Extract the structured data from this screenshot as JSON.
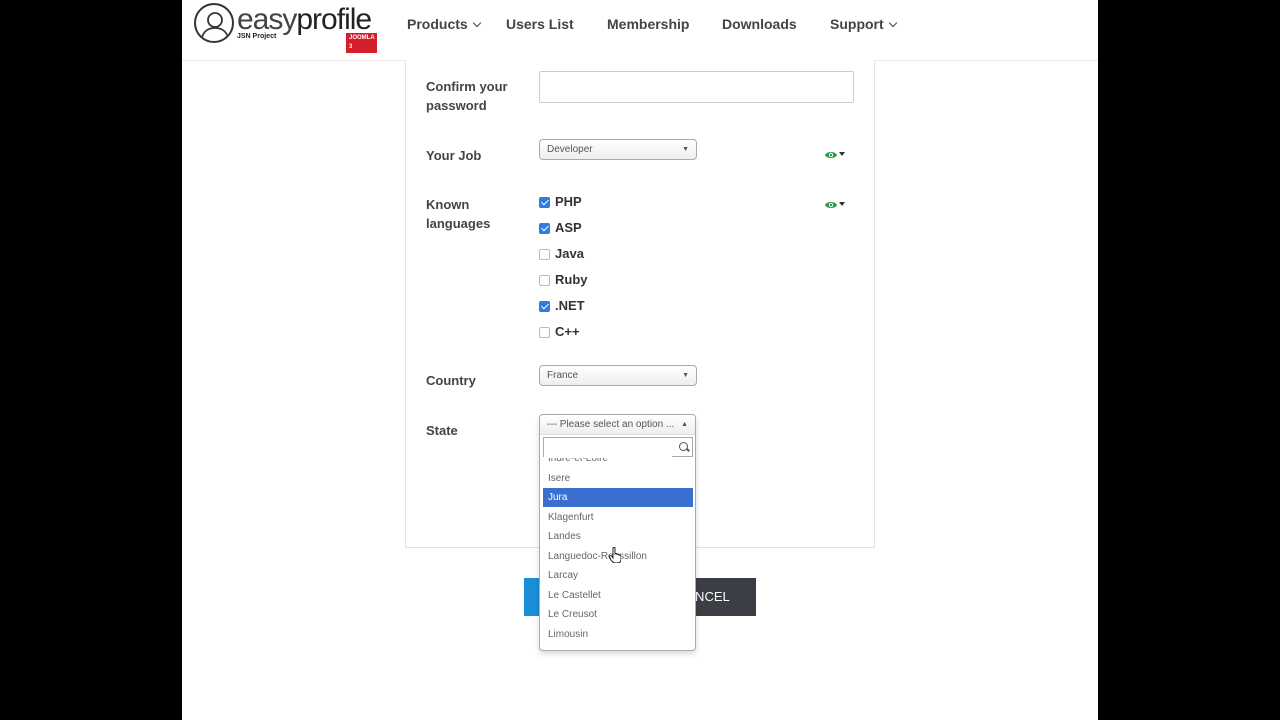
{
  "brand": {
    "name_light": "easy",
    "name_bold": "profile",
    "sub": "JSN Project",
    "badge": "JOOMLA 3"
  },
  "nav": [
    {
      "label": "Products",
      "dropdown": true
    },
    {
      "label": "Users List",
      "dropdown": false
    },
    {
      "label": "Membership",
      "dropdown": false
    },
    {
      "label": "Downloads",
      "dropdown": false
    },
    {
      "label": "Support",
      "dropdown": true
    }
  ],
  "form": {
    "confirm_password_label": "Confirm your password",
    "confirm_password_value": "",
    "job_label": "Your Job",
    "job_value": "Developer",
    "languages_label": "Known languages",
    "languages": [
      {
        "label": "PHP",
        "checked": true
      },
      {
        "label": "ASP",
        "checked": true
      },
      {
        "label": "Java",
        "checked": false
      },
      {
        "label": "Ruby",
        "checked": false
      },
      {
        "label": ".NET",
        "checked": true
      },
      {
        "label": "C++",
        "checked": false
      }
    ],
    "country_label": "Country",
    "country_value": "France",
    "state_label": "State",
    "state_placeholder": "--- Please select an option ...",
    "state_search_value": "",
    "state_options": [
      "Indre-et-Loire",
      "Isere",
      "Jura",
      "Klagenfurt",
      "Landes",
      "Languedoc-Roussillon",
      "Larcay",
      "Le Castellet",
      "Le Creusot",
      "Limousin"
    ],
    "state_highlighted": "Jura"
  },
  "buttons": {
    "cancel_label": "CANCEL"
  },
  "colors": {
    "accent_blue": "#1a8fd8",
    "highlight": "#3a6fd1",
    "checkbox": "#2f7de1",
    "eye_green": "#2a9d3c",
    "dark_button": "#3b3e44",
    "badge_red": "#d21f2b"
  }
}
